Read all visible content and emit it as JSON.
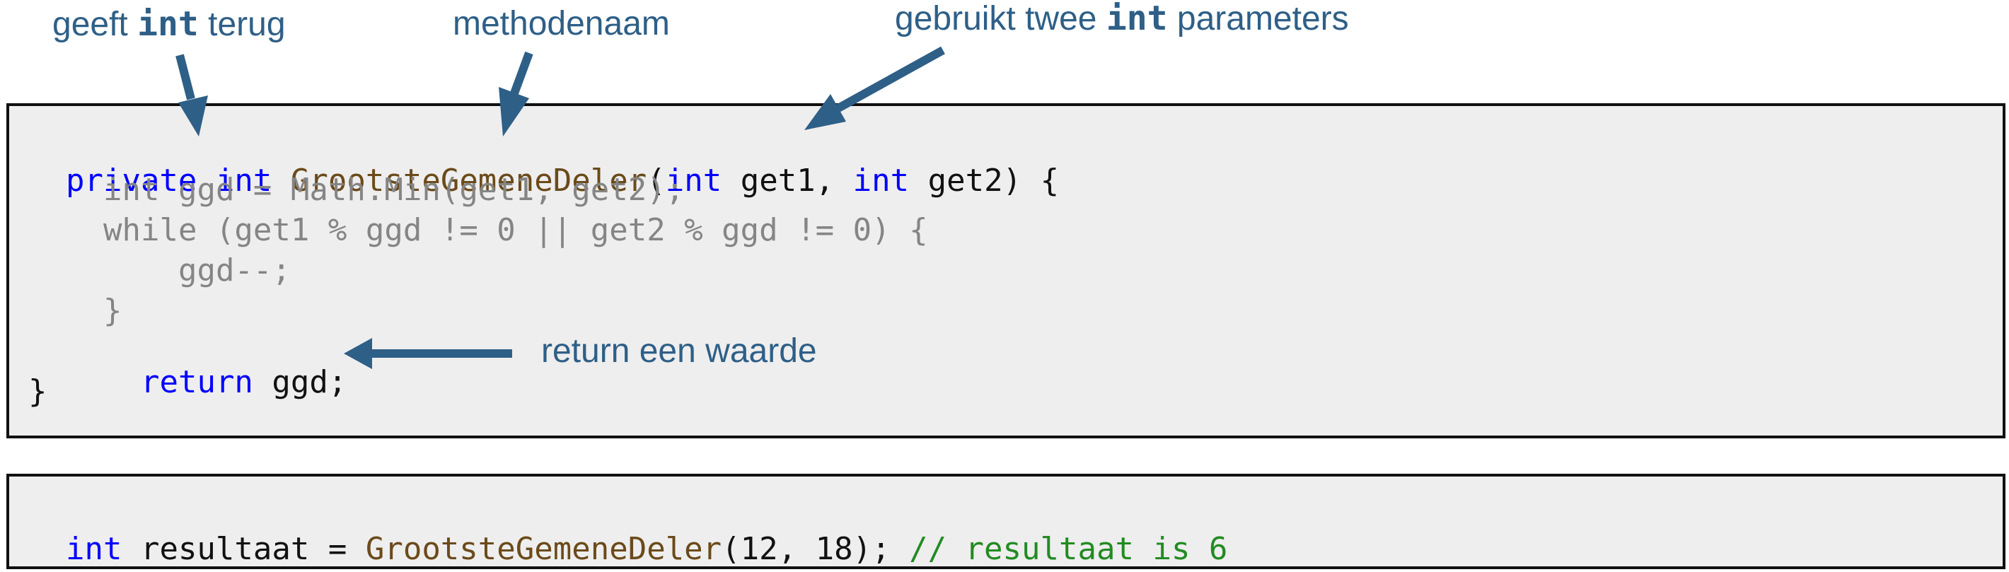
{
  "colors": {
    "annotation": "#2e5f87",
    "keyword": "#0000ff",
    "method": "#6b4a1a",
    "dimmed": "#858585",
    "comment": "#228b22",
    "text": "#111111",
    "code_background": "#eeeeee",
    "border": "#111111"
  },
  "annotations": {
    "returns_int": {
      "prefix": "geeft ",
      "keyword": "int",
      "suffix": " terug"
    },
    "method_name": {
      "text": "methodenaam"
    },
    "two_params": {
      "prefix": "gebruikt twee ",
      "keyword": "int",
      "suffix": " parameters"
    },
    "return_value": {
      "text": "return een waarde"
    }
  },
  "method_code": {
    "line1": {
      "t1": "private",
      "t2": " ",
      "t3": "int",
      "t4": " ",
      "t5": "GrootsteGemeneDeler",
      "t6": "(",
      "t7": "int",
      "t8": " get1, ",
      "t9": "int",
      "t10": " get2) {"
    },
    "line2": "int ggd = Math.Min(get1, get2);",
    "line3": "while (get1 % ggd != 0 || get2 % ggd != 0) {",
    "line4": "ggd--;",
    "line5": "}",
    "line6": {
      "t1": "return",
      "t2": " ggd;"
    },
    "line7": "}"
  },
  "call_code": {
    "t1": "int",
    "t2": " resultaat = ",
    "t3": "GrootsteGemeneDeler",
    "t4": "(12, 18); ",
    "t5": "// resultaat is 6"
  }
}
